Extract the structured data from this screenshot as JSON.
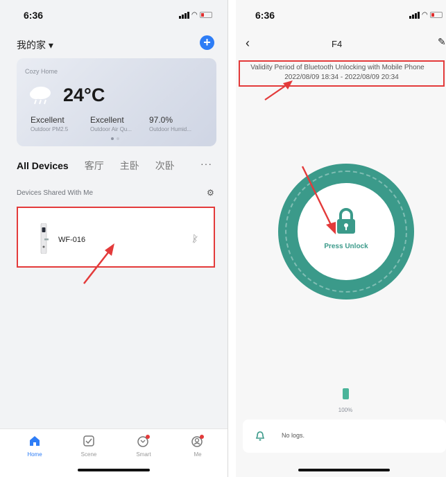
{
  "left": {
    "time": "6:36",
    "home_name": "我的家 ▾",
    "add_icon": "plus-icon",
    "weather": {
      "location": "Cozy Home",
      "temperature": "24°C",
      "stats": [
        {
          "value": "Excellent",
          "label": "Outdoor PM2.5"
        },
        {
          "value": "Excellent",
          "label": "Outdoor Air Qu..."
        },
        {
          "value": "97.0%",
          "label": "Outdoor Humid..."
        }
      ]
    },
    "tabs": [
      "All Devices",
      "客厅",
      "主卧",
      "次卧"
    ],
    "more": "···",
    "shared_title": "Devices Shared With Me",
    "device": {
      "name": "WF-016"
    },
    "tabbar": [
      "Home",
      "Scene",
      "Smart",
      "Me"
    ]
  },
  "right": {
    "time": "6:36",
    "title": "F4",
    "validity_title": "Validity Period of Bluetooth Unlocking with Mobile Phone",
    "validity_dates": "2022/08/09 18:34 - 2022/08/09 20:34",
    "press_unlock": "Press Unlock",
    "battery_pct": "100%",
    "battery_level": 1.0,
    "logs": "No logs."
  },
  "colors": {
    "accent_blue": "#2e7df6",
    "lock_green": "#3b9a8a",
    "highlight_red": "#e33a3a"
  }
}
